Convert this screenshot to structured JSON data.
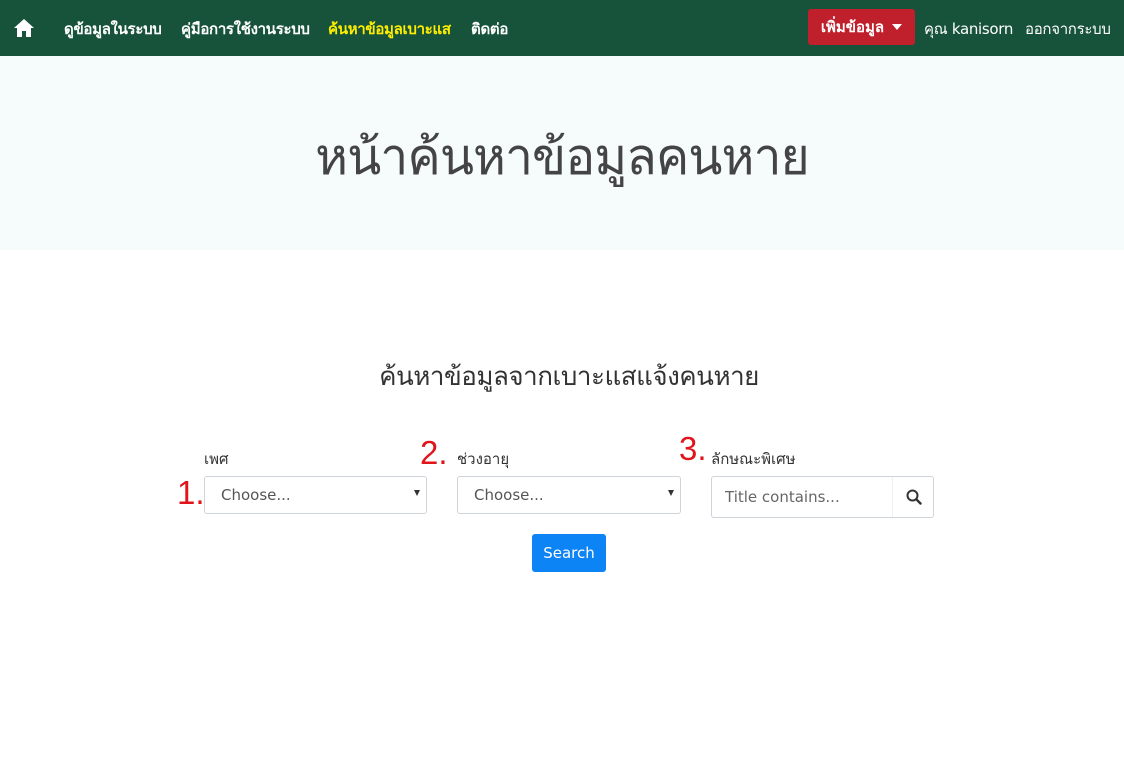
{
  "navbar": {
    "home_icon": "home-icon",
    "links": [
      {
        "label": "ดูข้อมูลในระบบ",
        "active": false
      },
      {
        "label": "คู่มือการใช้งานระบบ",
        "active": false
      },
      {
        "label": "ค้นหาข้อมูลเบาะแส",
        "active": true
      },
      {
        "label": "ติดต่อ",
        "active": false
      }
    ],
    "add_button_label": "เพิ่มข้อมูล",
    "user_label": "คุณ kanisorn",
    "logout_label": "ออกจากระบบ",
    "colors": {
      "background": "#17523a",
      "active_link": "#ffee00",
      "add_button": "#c0202b"
    }
  },
  "hero": {
    "title": "หน้าค้นหาข้อมูลคนหาย"
  },
  "search_section": {
    "title": "ค้นหาข้อมูลจากเบาะแสแจ้งคนหาย",
    "markers": [
      "1.",
      "2.",
      "3."
    ],
    "gender": {
      "label": "เพศ",
      "selected": "Choose..."
    },
    "age_range": {
      "label": "ช่วงอายุ",
      "selected": "Choose..."
    },
    "features": {
      "label": "ลักษณะพิเศษ",
      "placeholder": "Title contains...",
      "icon": "search-icon"
    },
    "search_button_label": "Search",
    "colors": {
      "search_button": "#0d84f5",
      "marker": "#e0141b"
    }
  }
}
